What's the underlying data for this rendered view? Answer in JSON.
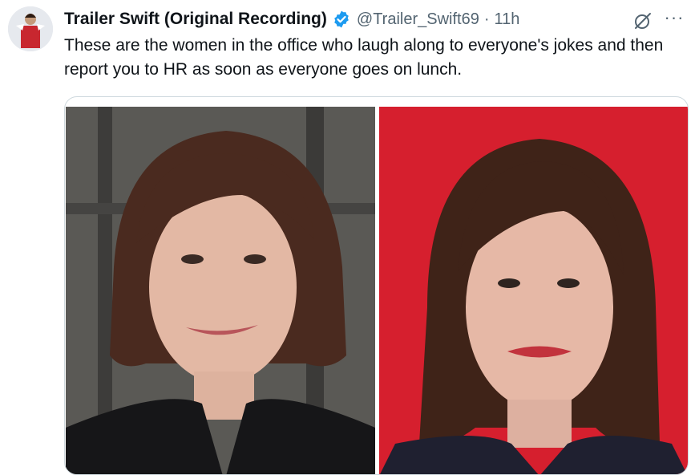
{
  "author": {
    "display_name": "Trailer Swift (Original Recording)",
    "handle": "@Trailer_Swift69",
    "separator": "·",
    "timestamp": "11h",
    "verified_icon": "verified-badge-icon",
    "avatar_icon": "avatar"
  },
  "tweet": {
    "text": "These are the women in the office who laugh along to everyone's jokes and then report you to HR as soon as everyone goes on lunch."
  },
  "actions": {
    "grok_icon": "grok-icon",
    "more_label": "···"
  },
  "media": {
    "count": 2
  },
  "colors": {
    "text": "#0f1419",
    "secondary": "#536471",
    "verified": "#1d9bf0",
    "photo_right_bg": "#d61f2e"
  }
}
